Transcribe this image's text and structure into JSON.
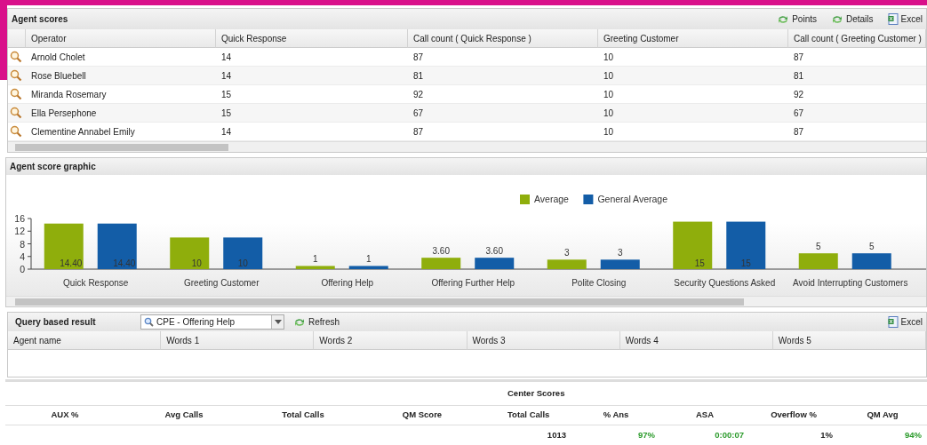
{
  "agent_scores": {
    "title": "Agent scores",
    "actions": [
      {
        "label": "Points",
        "kind": "refresh"
      },
      {
        "label": "Details",
        "kind": "refresh"
      },
      {
        "label": "Excel",
        "kind": "excel"
      }
    ],
    "columns": [
      "Operator",
      "Quick Response",
      "Call count ( Quick Response )",
      "Greeting Customer",
      "Call count ( Greeting Customer )"
    ],
    "rows": [
      [
        "Arnold Cholet",
        "14",
        "87",
        "10",
        "87"
      ],
      [
        "Rose Bluebell",
        "14",
        "81",
        "10",
        "81"
      ],
      [
        "Miranda Rosemary",
        "15",
        "92",
        "10",
        "92"
      ],
      [
        "Ella Persephone",
        "15",
        "67",
        "10",
        "67"
      ],
      [
        "Clementine Annabel Emily",
        "14",
        "87",
        "10",
        "87"
      ]
    ]
  },
  "agent_score_graphic": {
    "title": "Agent score graphic",
    "chart_data": {
      "type": "bar",
      "categories": [
        "Quick Response",
        "Greeting Customer",
        "Offering Help",
        "Offering Further Help",
        "Polite Closing",
        "Security Questions Asked",
        "Avoid Interrupting Customers"
      ],
      "series": [
        {
          "name": "Average",
          "color": "#8fae0c",
          "values": [
            14.4,
            10,
            1,
            3.6,
            3,
            15,
            5
          ]
        },
        {
          "name": "General Average",
          "color": "#135da7",
          "values": [
            14.4,
            10,
            1,
            3.6,
            3,
            15,
            5
          ]
        }
      ],
      "value_labels": [
        [
          "14.40",
          "10",
          "1",
          "3.60",
          "3",
          "15",
          "5"
        ],
        [
          "14.40",
          "10",
          "1",
          "3.60",
          "3",
          "15",
          "5"
        ]
      ],
      "legend": "top",
      "ylim": [
        0,
        16
      ],
      "yticks": [
        0,
        4,
        8,
        12,
        16
      ]
    }
  },
  "query_result": {
    "title": "Query based result",
    "query": "CPE - Offering Help",
    "refresh": "Refresh",
    "excel": "Excel",
    "columns": [
      "Agent name",
      "Words 1",
      "Words 2",
      "Words 3",
      "Words 4",
      "Words 5"
    ]
  },
  "center": {
    "title": "Center Scores",
    "left_columns": [
      "AUX %",
      "Avg Calls",
      "Total Calls",
      "QM Score"
    ],
    "columns": [
      "Total Calls",
      "% Ans",
      "ASA",
      "Overflow %",
      "QM Avg"
    ],
    "values": [
      {
        "text": "1013",
        "good": false
      },
      {
        "text": "97%",
        "good": true
      },
      {
        "text": "0:00:07",
        "good": true
      },
      {
        "text": "1%",
        "good": false
      },
      {
        "text": "94%",
        "good": true
      }
    ]
  }
}
